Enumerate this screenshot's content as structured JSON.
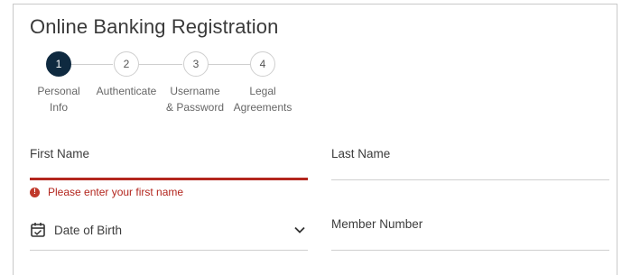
{
  "page": {
    "title": "Online Banking Registration"
  },
  "stepper": {
    "steps": [
      {
        "number": "1",
        "label_line1": "Personal",
        "label_line2": "Info",
        "active": true
      },
      {
        "number": "2",
        "label_line1": "Authenticate",
        "label_line2": "",
        "active": false
      },
      {
        "number": "3",
        "label_line1": "Username",
        "label_line2": "& Password",
        "active": false
      },
      {
        "number": "4",
        "label_line1": "Legal",
        "label_line2": "Agreements",
        "active": false
      }
    ]
  },
  "form": {
    "first_name": {
      "label": "First Name",
      "value": "",
      "error": "Please enter your first name"
    },
    "last_name": {
      "label": "Last Name",
      "value": ""
    },
    "date_of_birth": {
      "label": "Date of Birth"
    },
    "member_number": {
      "label": "Member Number",
      "value": ""
    }
  },
  "colors": {
    "active_step": "#0f2a40",
    "error": "#b3261e",
    "divider": "#cfcfcf"
  }
}
